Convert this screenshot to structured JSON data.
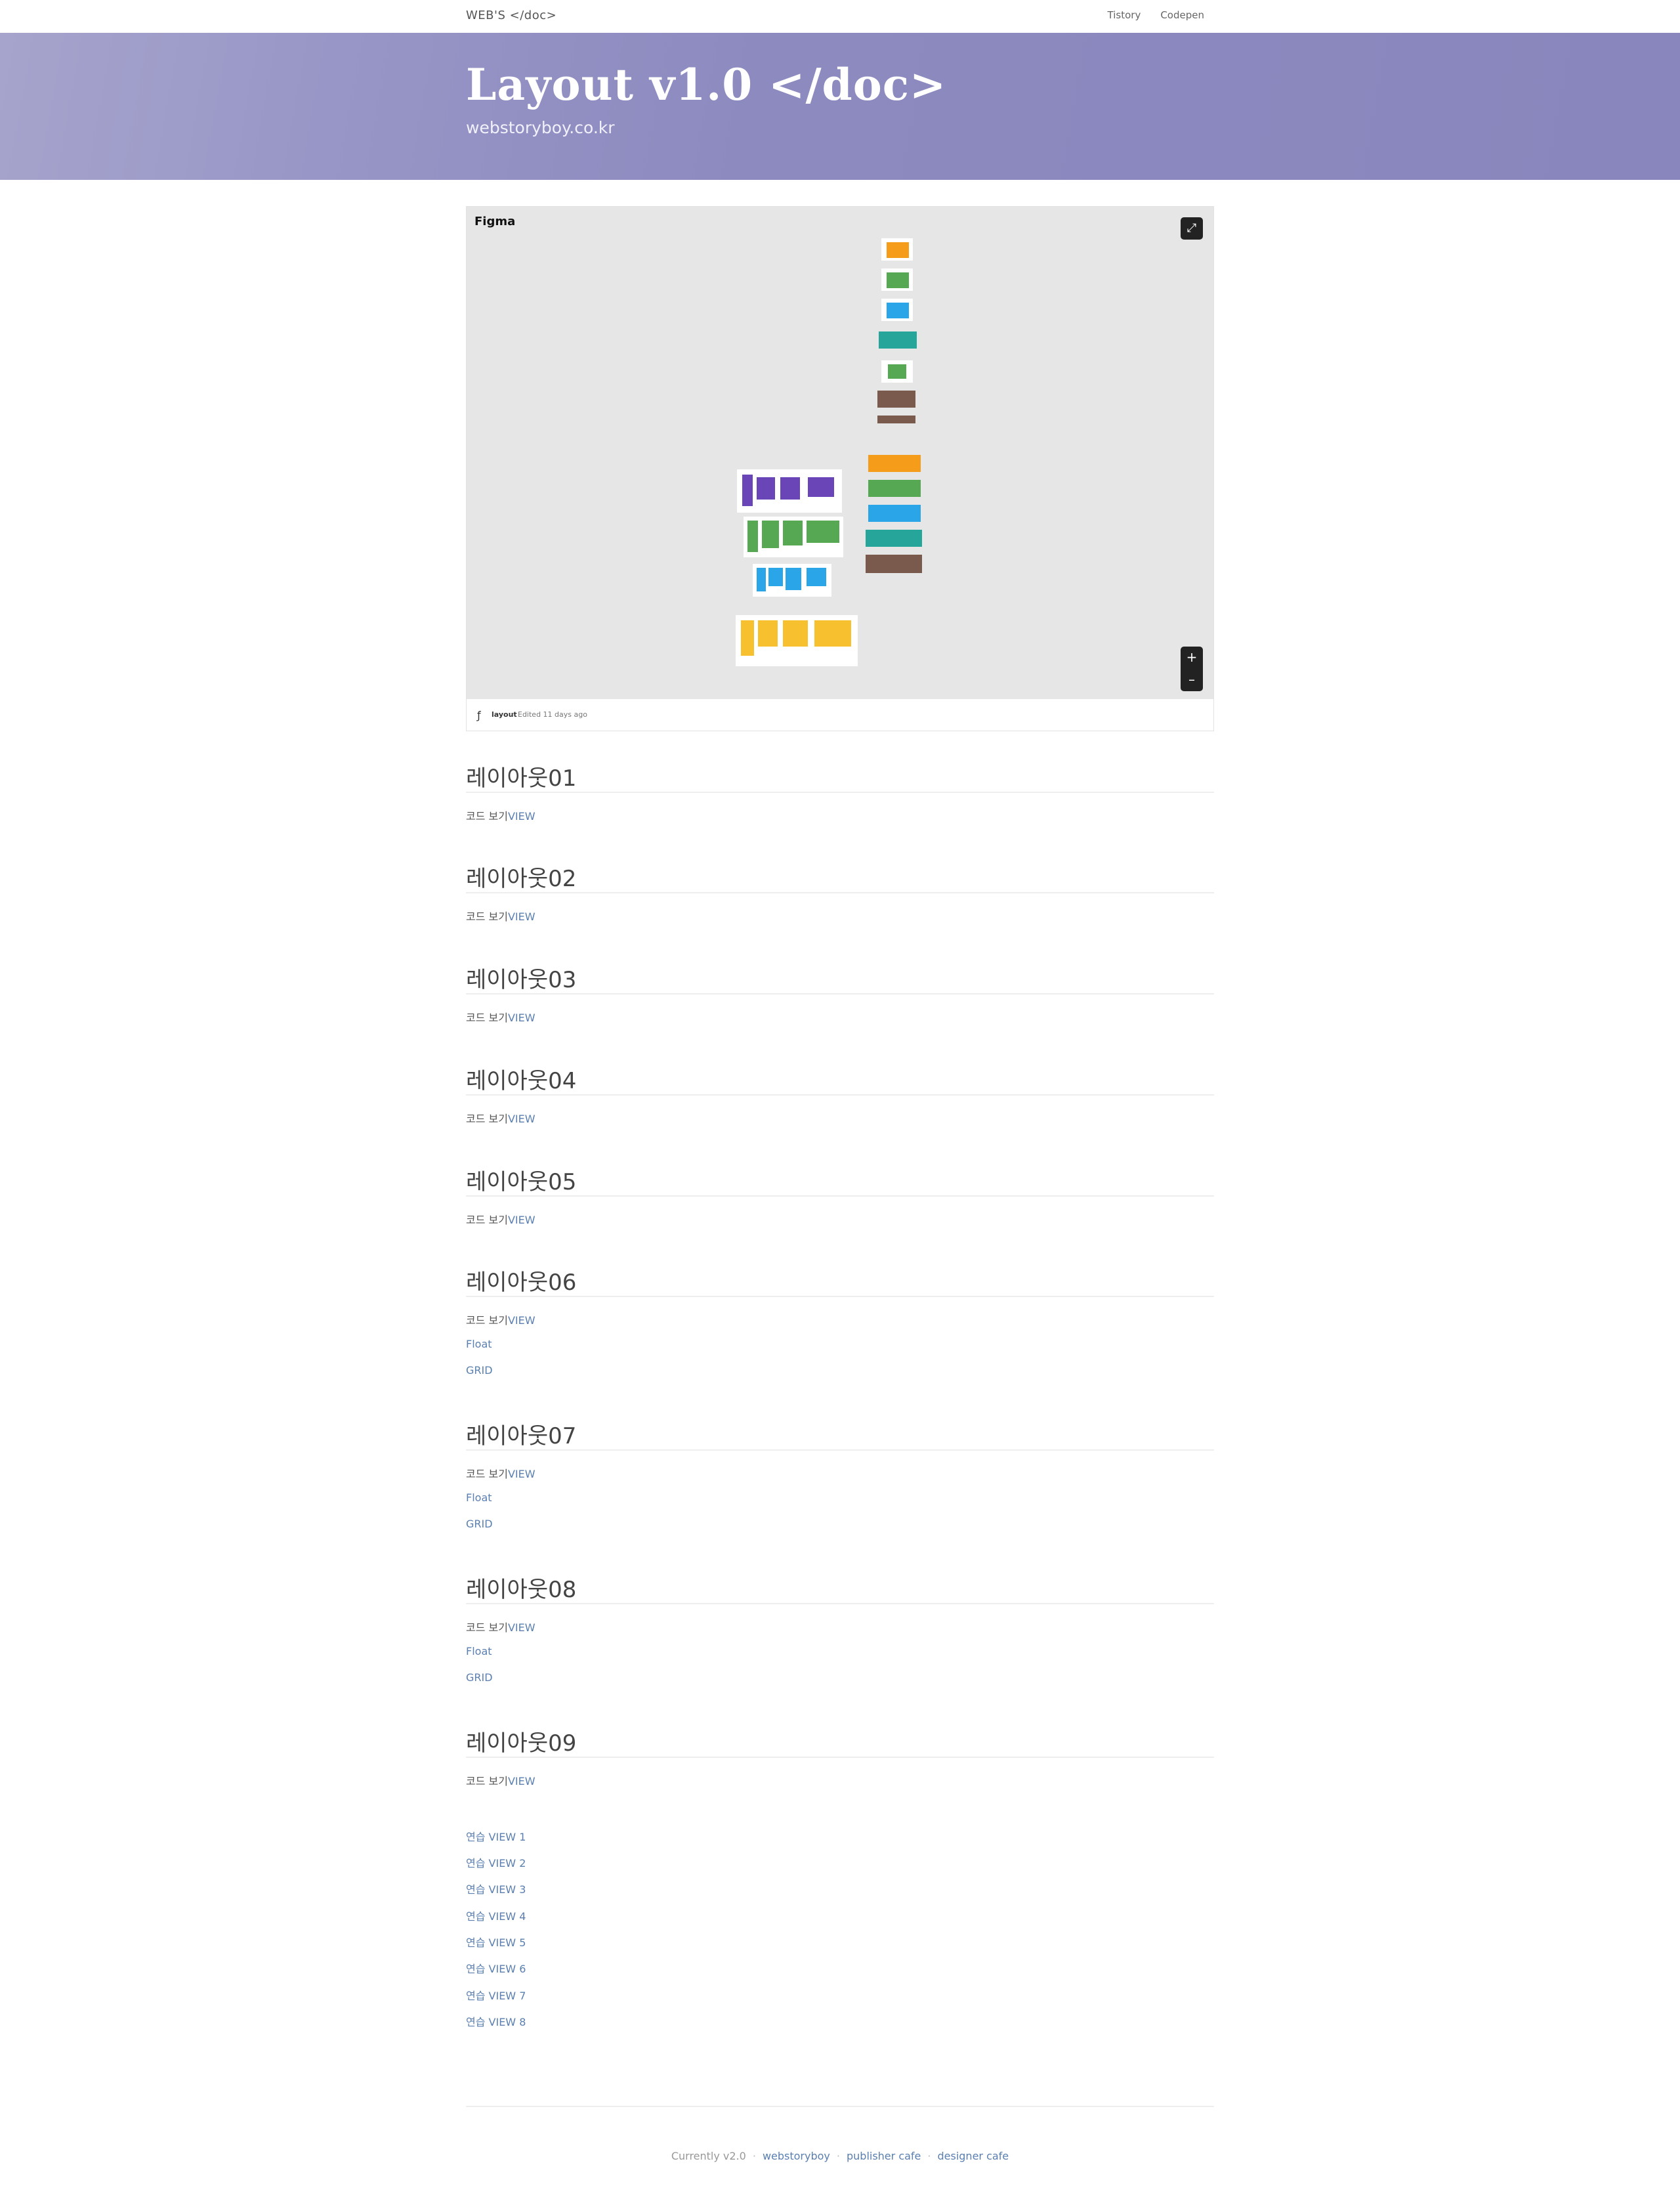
{
  "nav": {
    "brand": "WEB'S </doc>",
    "links": [
      "Tistory",
      "Codepen"
    ]
  },
  "hero": {
    "title": "Layout v1.0 </doc>",
    "subtitle": "webstoryboy.co.kr"
  },
  "figma": {
    "label": "Figma",
    "file_name": "layout",
    "edited": "Edited 11 days ago",
    "zoom_in": "+",
    "zoom_out": "–"
  },
  "sections": [
    {
      "title": "레이아웃01",
      "code_label": "코드 보기",
      "view": "VIEW",
      "links": []
    },
    {
      "title": "레이아웃02",
      "code_label": "코드 보기",
      "view": "VIEW",
      "links": []
    },
    {
      "title": "레이아웃03",
      "code_label": "코드 보기",
      "view": "VIEW",
      "links": []
    },
    {
      "title": "레이아웃04",
      "code_label": "코드 보기",
      "view": "VIEW",
      "links": []
    },
    {
      "title": "레이아웃05",
      "code_label": "코드 보기",
      "view": "VIEW",
      "links": []
    },
    {
      "title": "레이아웃06",
      "code_label": "코드 보기",
      "view": "VIEW",
      "links": [
        "Float",
        "GRID"
      ]
    },
    {
      "title": "레이아웃07",
      "code_label": "코드 보기",
      "view": "VIEW",
      "links": [
        "Float",
        "GRID"
      ]
    },
    {
      "title": "레이아웃08",
      "code_label": "코드 보기",
      "view": "VIEW",
      "links": [
        "Float",
        "GRID"
      ]
    },
    {
      "title": "레이아웃09",
      "code_label": "코드 보기",
      "view": "VIEW",
      "links": []
    }
  ],
  "practice": [
    "연습 VIEW 1",
    "연습 VIEW 2",
    "연습 VIEW 3",
    "연습 VIEW 4",
    "연습 VIEW 5",
    "연습 VIEW 6",
    "연습 VIEW 7",
    "연습 VIEW 8"
  ],
  "footer": {
    "version": "Currently v2.0",
    "links": [
      "webstoryboy",
      "publisher cafe",
      "designer cafe"
    ]
  },
  "colors": {
    "hero": "#8886bc",
    "link": "#5a7fb0",
    "orange": "#f59c1a",
    "green": "#56a852",
    "blue": "#2aa6e8",
    "teal": "#26a69a",
    "brown": "#7a5a4d",
    "purple": "#6a45b8",
    "yellow": "#f7c02f"
  }
}
